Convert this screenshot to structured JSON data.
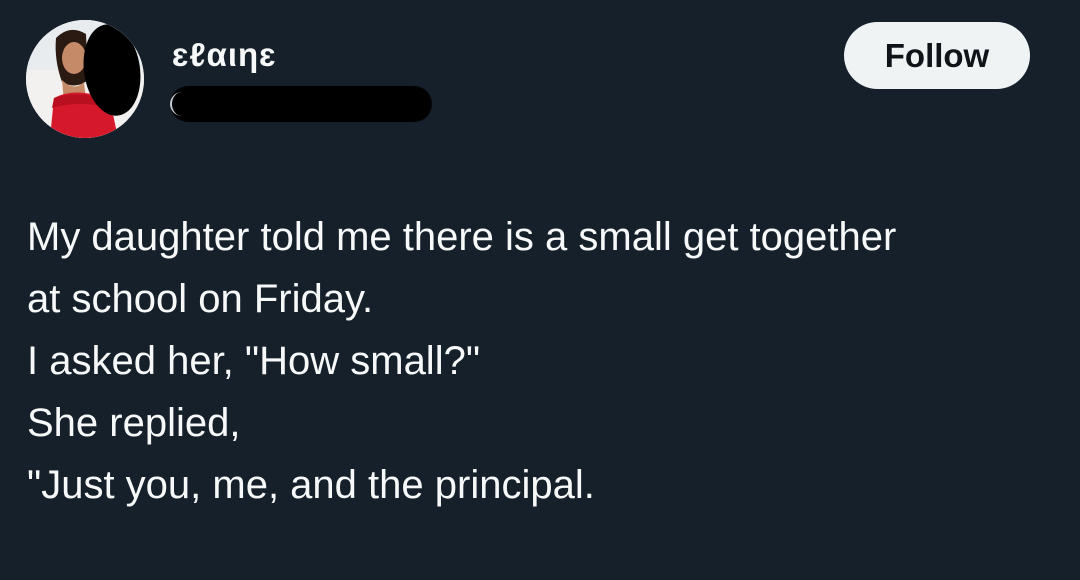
{
  "author": {
    "display_name": "ɛℓαιηɛ",
    "handle": ""
  },
  "actions": {
    "follow_label": "Follow"
  },
  "tweet": {
    "lines": [
      "My daughter told me there is a small get together",
      "at school on Friday.",
      "I asked her, \"How small?\"",
      "She replied,",
      "\"Just you, me, and the principal."
    ]
  },
  "colors": {
    "background": "#15202b",
    "text": "#f7f9f9",
    "button_bg": "#eff3f4",
    "button_text": "#0f1419"
  }
}
